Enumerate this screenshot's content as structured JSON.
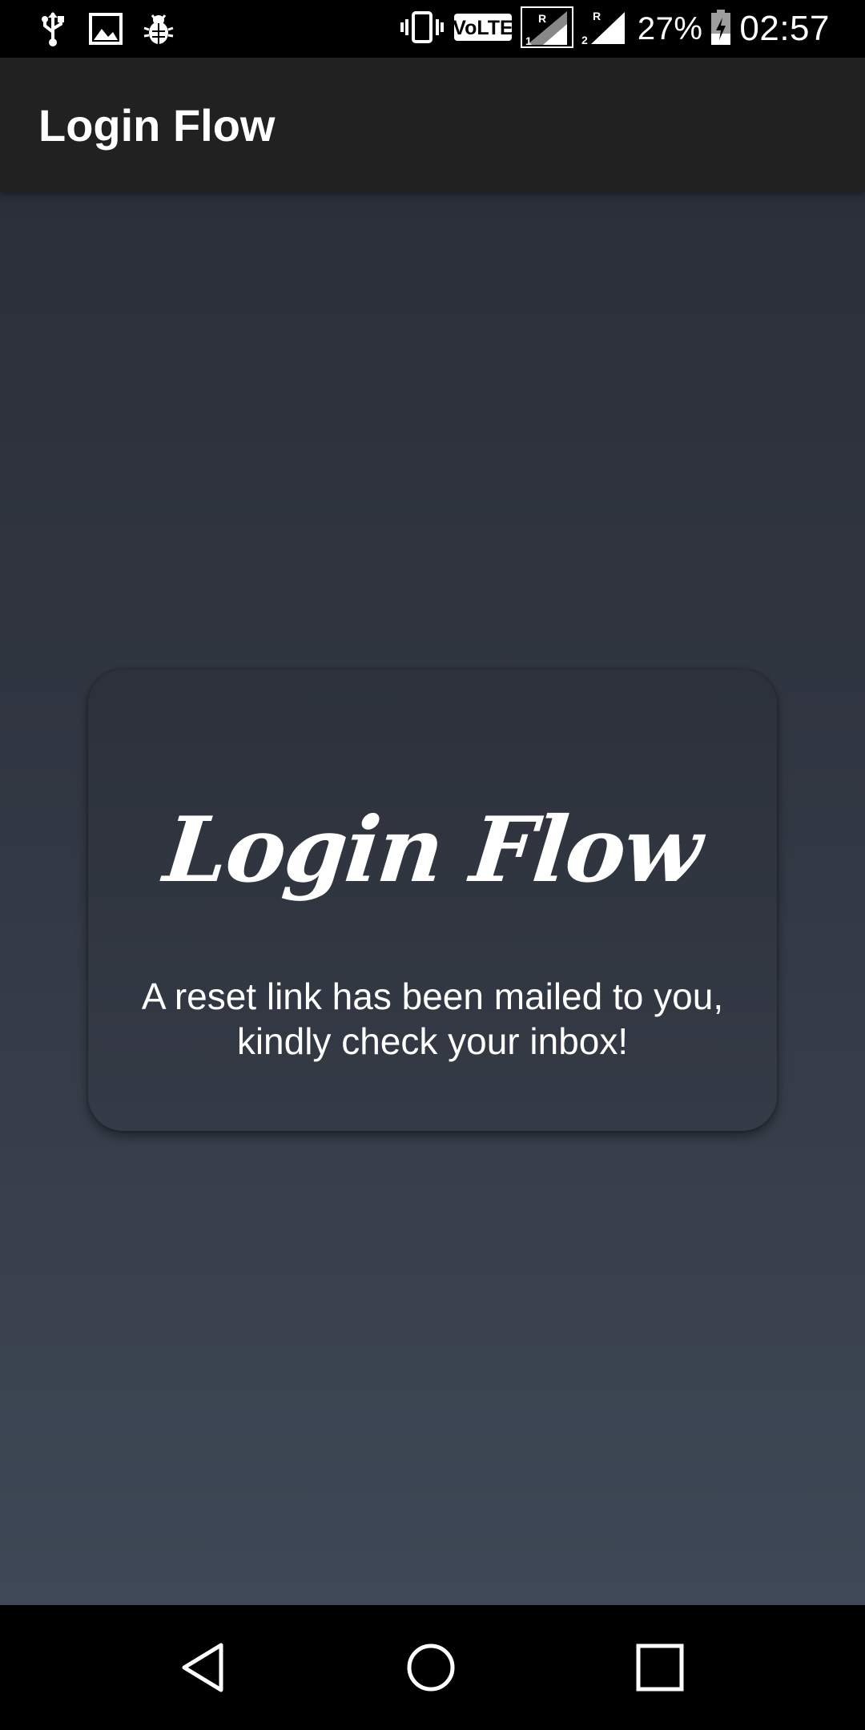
{
  "status_bar": {
    "left_icons": [
      "usb-icon",
      "image-icon",
      "bug-icon"
    ],
    "right_icons": [
      "vibrate-icon",
      "volte-icon",
      "signal-sim1-icon",
      "signal-sim2-icon",
      "battery-charging-icon"
    ],
    "volte_label": "VoLTE",
    "battery_percent": "27%",
    "time": "02:57"
  },
  "app_bar": {
    "title": "Login Flow"
  },
  "card": {
    "logo_text": "Login Flow",
    "message": "A reset link has been mailed to you, kindly check your inbox!"
  },
  "nav_bar": {
    "buttons": [
      "back-icon",
      "home-icon",
      "recents-icon"
    ]
  },
  "colors": {
    "status_bar_bg": "#000000",
    "app_bar_bg": "#212121",
    "content_gradient_top": "#2b2f39",
    "content_gradient_bottom": "#3e4856",
    "card_bg": "#313641",
    "text": "#ffffff"
  }
}
